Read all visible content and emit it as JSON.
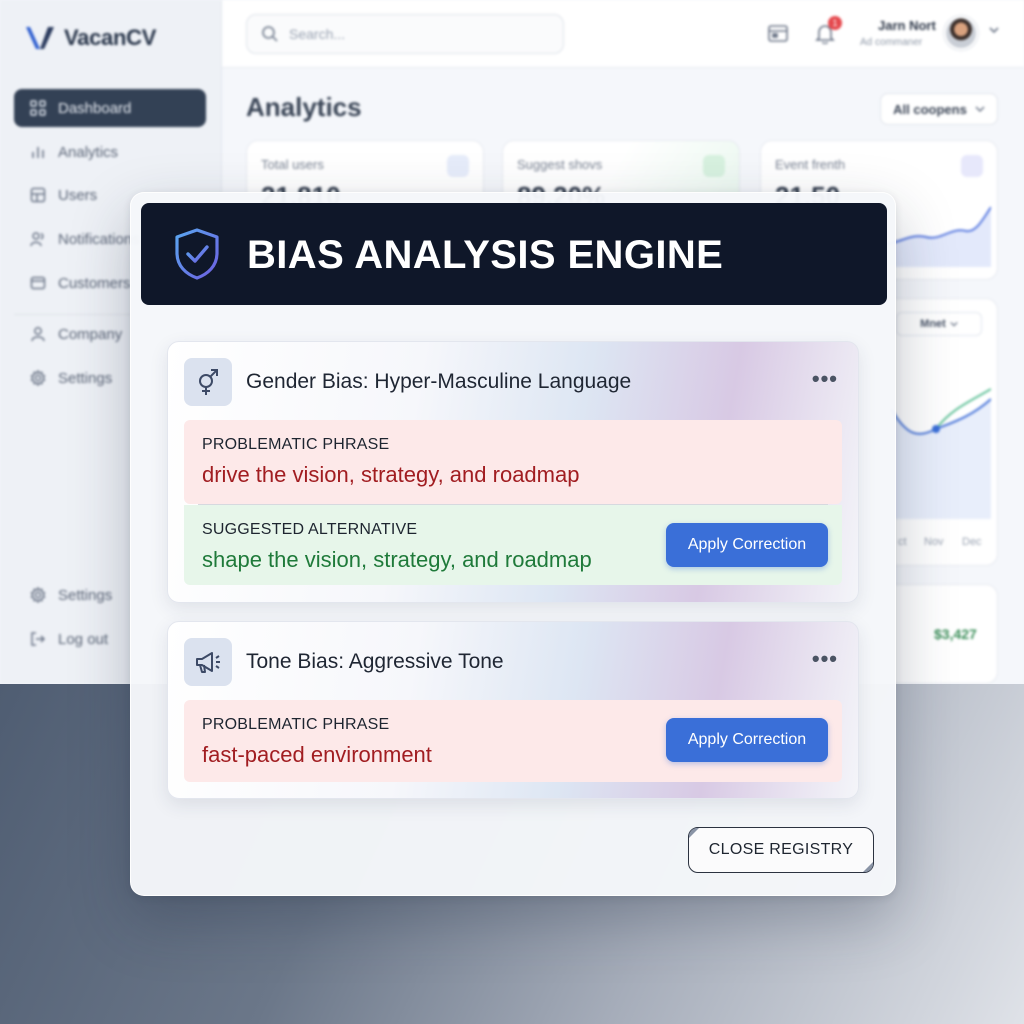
{
  "app": {
    "name": "VacanCV"
  },
  "sidebar": {
    "items": [
      {
        "label": "Dashboard",
        "icon": "grid-icon",
        "active": true
      },
      {
        "label": "Analytics",
        "icon": "bar-chart-icon"
      },
      {
        "label": "Users",
        "icon": "users-table-icon"
      },
      {
        "label": "Notifications",
        "icon": "people-icon"
      },
      {
        "label": "Customers",
        "icon": "folder-icon"
      },
      {
        "label": "Company",
        "icon": "person-icon"
      },
      {
        "label": "Settings",
        "icon": "gear-icon"
      }
    ],
    "footer": [
      {
        "label": "Settings",
        "icon": "gear-icon"
      },
      {
        "label": "Log out",
        "icon": "logout-icon"
      }
    ]
  },
  "topbar": {
    "search_placeholder": "Search...",
    "notification_count": "1",
    "user_name": "Jarn Nort",
    "user_role": "Ad commaner"
  },
  "main": {
    "title": "Analytics",
    "filter_label": "All coopens",
    "stats": [
      {
        "label": "Total users",
        "value": "21,810"
      },
      {
        "label": "Suggest shovs",
        "value": "89.20%"
      },
      {
        "label": "Event frenth",
        "value": "21.50"
      }
    ],
    "chart_filter": "Mnet",
    "chart_axis": [
      "ct",
      "Nov",
      "Dec"
    ],
    "revenue": "$3,427"
  },
  "modal": {
    "title": "BIAS ANALYSIS ENGINE",
    "issues": [
      {
        "title": "Gender Bias: Hyper-Masculine Language",
        "icon": "gender-symbol-icon",
        "problem_label": "PROBLEMATIC PHRASE",
        "problem_text": "drive the vision, strategy, and roadmap",
        "alt_label": "SUGGESTED ALTERNATIVE",
        "alt_text": "shape the vision, strategy, and roadmap",
        "button": "Apply Correction"
      },
      {
        "title": "Tone Bias: Aggressive Tone",
        "icon": "megaphone-icon",
        "problem_label": "PROBLEMATIC PHRASE",
        "problem_text": "fast-paced environment",
        "button": "Apply Correction"
      }
    ],
    "close_label": "CLOSE REGISTRY"
  },
  "colors": {
    "header_bg": "#0f1729",
    "accent_blue": "#3a6fd8",
    "problem_bg": "#fde9e9",
    "problem_text": "#a11d21",
    "alt_bg": "#e7f6ea",
    "alt_text": "#1f7a3a"
  }
}
